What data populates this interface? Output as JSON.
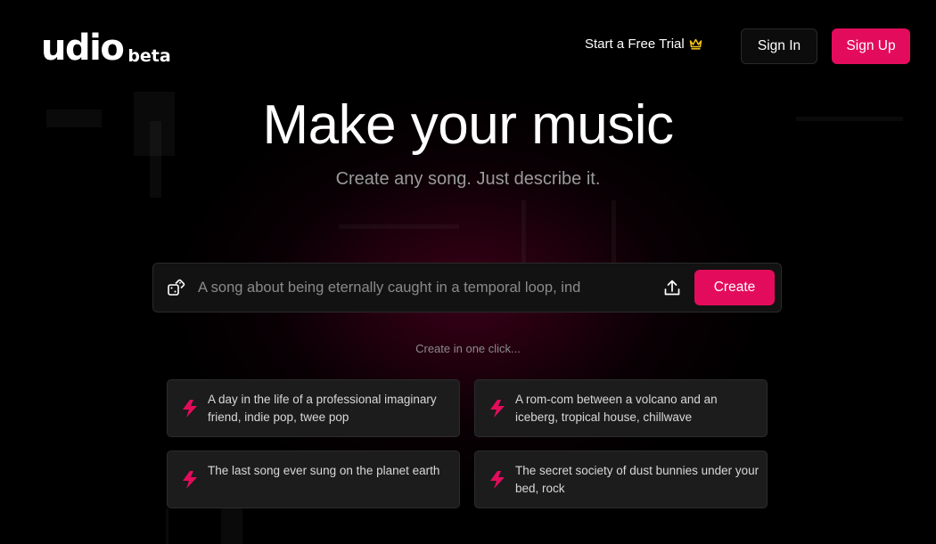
{
  "header": {
    "logo_text": "udio",
    "logo_badge": "beta",
    "trial_link": "Start a Free Trial",
    "trial_icon": "crown-icon",
    "sign_in": "Sign In",
    "sign_up": "Sign Up"
  },
  "hero": {
    "title": "Make your music",
    "subtitle": "Create any song. Just describe it."
  },
  "prompt": {
    "placeholder": "A song about being eternally caught in a temporal loop, ind",
    "value": "",
    "random_icon": "dice-icon",
    "upload_icon": "upload-icon",
    "create_label": "Create"
  },
  "suggestions": {
    "heading": "Create in one click...",
    "icon": "lightning-bolt-icon",
    "items": [
      {
        "text": "A day in the life of a professional imaginary friend, indie pop, twee pop"
      },
      {
        "text": "A rom-com between a volcano and an iceberg, tropical house, chillwave"
      },
      {
        "text": "The last song ever sung on the planet earth"
      },
      {
        "text": "The secret society of dust bunnies under your bed, rock"
      }
    ]
  },
  "colors": {
    "accent": "#e30c5c",
    "crown": "#f5c518",
    "background": "#000000",
    "card": "#1c1c1c"
  }
}
